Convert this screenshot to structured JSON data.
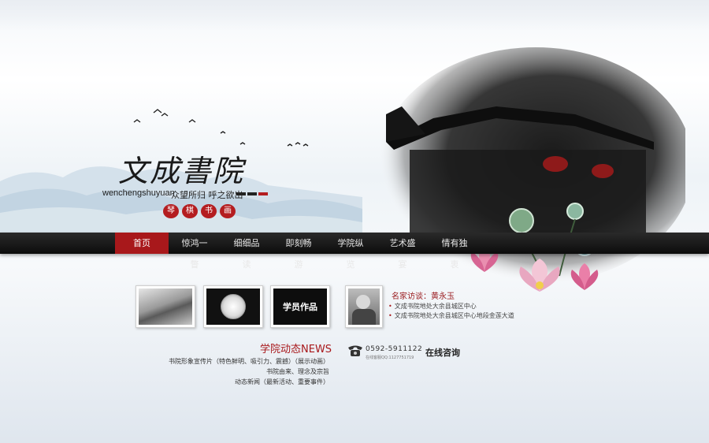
{
  "brand": {
    "name_cn": "文成書院",
    "name_pinyin": "wenchengshuyuan",
    "slogan": "众望所归 呼之欲出",
    "seals": [
      "琴",
      "棋",
      "书",
      "画"
    ]
  },
  "nav": {
    "items": [
      "首页",
      "惊鸿一瞥",
      "细细品读",
      "即刻畅游",
      "学院纵览",
      "艺术盛宴",
      "情有独衷"
    ],
    "active_index": 0
  },
  "gallery": {
    "student_works_label": "学员作品"
  },
  "visit": {
    "title": "名家访谈：黄永玉",
    "items": [
      "文成书院地处大余县城区中心",
      "文成书院地处大余县城区中心地段金莲大道"
    ]
  },
  "news": {
    "title": "学院动态NEWS",
    "items": [
      "书院形象宣传片（特色鲜明、吸引力、震撼）（展示动画）",
      "书院由来、理念及宗旨",
      "动态新闻（最新活动、重要事件）"
    ]
  },
  "contact": {
    "phone": "0592-5911122",
    "qq": "在线客服QQ:1127751719",
    "consult_label": "在线咨询"
  },
  "colors": {
    "accent_red": "#a8181b",
    "nav_bg": "#111111"
  },
  "icons": {
    "phone": "phone-icon",
    "bullet": "dot-icon"
  }
}
